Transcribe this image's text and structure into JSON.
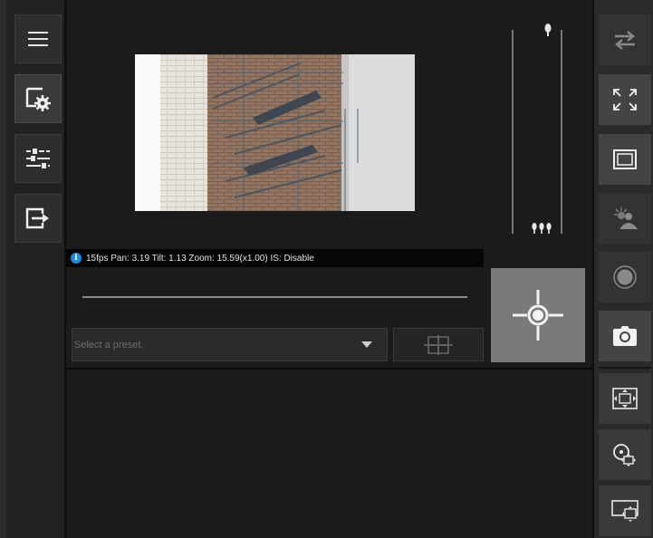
{
  "left_toolbar": {
    "items": [
      {
        "icon": "menu-icon"
      },
      {
        "icon": "settings-window-icon"
      },
      {
        "icon": "sliders-icon"
      },
      {
        "icon": "exit-icon"
      }
    ]
  },
  "status": {
    "text": "15fps Pan: 3.19 Tilt: 1.13 Zoom: 15.59(x1.00) IS: Disable"
  },
  "preset": {
    "placeholder": "Select a preset."
  },
  "right_toolbar": {
    "items": [
      {
        "icon": "swap-arrows-icon"
      },
      {
        "icon": "fullscreen-icon"
      },
      {
        "icon": "frame-icon"
      },
      {
        "icon": "smart-shade-icon"
      },
      {
        "icon": "record-icon"
      },
      {
        "icon": "snapshot-camera-icon"
      },
      {
        "icon": "fit-view-icon"
      },
      {
        "icon": "click-zoom-icon"
      },
      {
        "icon": "area-zoom-icon"
      }
    ]
  },
  "colors": {
    "accent_info": "#1e88e5",
    "background": "#1b1b1b",
    "toolbar": "#2a2a2a"
  }
}
